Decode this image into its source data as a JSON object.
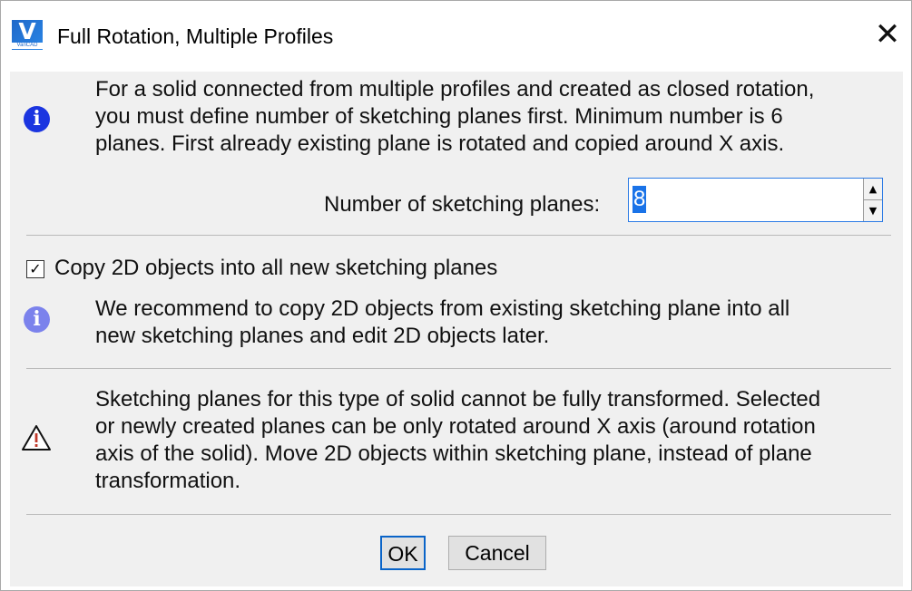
{
  "window": {
    "title": "Full Rotation, Multiple Profiles",
    "app_icon_letter": "V",
    "app_icon_caption": "VariCAD",
    "close_glyph": "✕"
  },
  "info1": {
    "icon": "info-icon",
    "icon_color": "#1b35e0",
    "text_lines": [
      "For a solid connected from multiple profiles and created as closed rotation,",
      "you must define number of sketching planes first. Minimum number is 6",
      "planes. First already existing plane is rotated and copied around X axis."
    ]
  },
  "planes": {
    "label": "Number of sketching planes:",
    "value": "8",
    "up_glyph": "▲",
    "down_glyph": "▼"
  },
  "copy_option": {
    "checked": true,
    "check_glyph": "✓",
    "label": "Copy 2D objects into all new sketching planes"
  },
  "info2": {
    "icon": "info-icon",
    "icon_color": "#7b82ec",
    "text_lines": [
      "We recommend to copy 2D objects from existing sketching plane into all",
      "new sketching planes and edit 2D objects later."
    ]
  },
  "warning": {
    "icon": "warning-triangle-icon",
    "icon_color": "#c0392b",
    "text_lines": [
      "Sketching planes for this type of solid cannot be fully transformed. Selected",
      "or newly created planes can be only rotated around X axis (around rotation",
      "axis of the solid). Move 2D objects within sketching plane, instead of plane",
      "transformation."
    ]
  },
  "buttons": {
    "ok_label": "OK",
    "cancel_label": "Cancel"
  }
}
